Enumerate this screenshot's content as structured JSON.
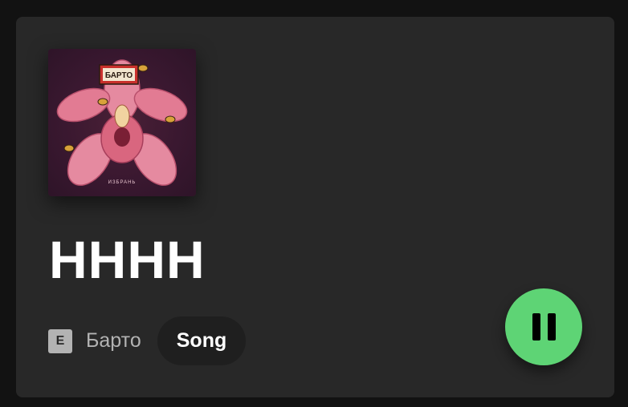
{
  "track": {
    "title": "НННН",
    "explicit_badge": "E",
    "artist": "Барто",
    "type": "Song",
    "cover": {
      "logo_text": "БАРТО",
      "album_text": "ИЗБРАНЬ",
      "background_color": "#3a1830",
      "flower_color": "#e27b93"
    }
  },
  "colors": {
    "card_background": "#282828",
    "accent_green": "#5ed475",
    "secondary_text": "#b3b3b3"
  },
  "controls": {
    "pause_icon": "pause-icon"
  }
}
